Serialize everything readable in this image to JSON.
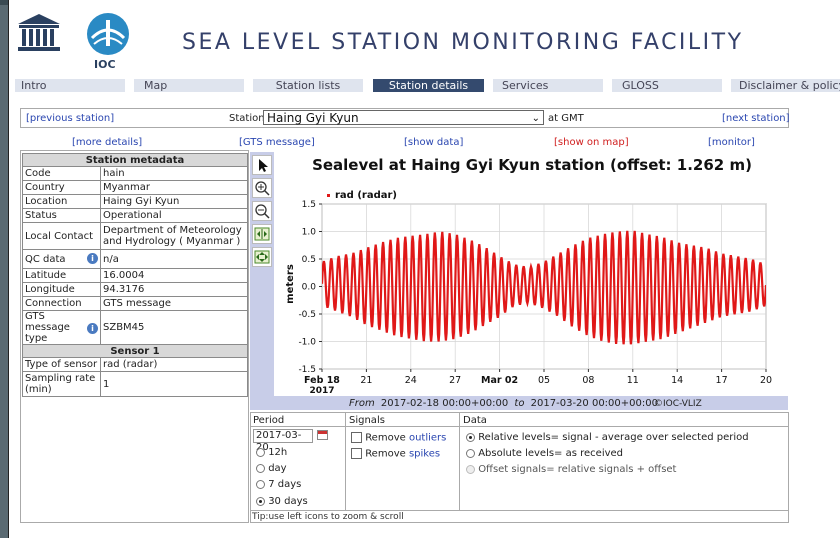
{
  "header": {
    "title": "SEA LEVEL STATION MONITORING FACILITY",
    "ioc_label": "IOC"
  },
  "nav": [
    {
      "label": "Intro",
      "active": false
    },
    {
      "label": "Map",
      "active": false
    },
    {
      "label": "Station lists",
      "active": false
    },
    {
      "label": "Station details",
      "active": true
    },
    {
      "label": "Services",
      "active": false
    },
    {
      "label": "GLOSS",
      "active": false
    },
    {
      "label": "Disclaimer & policy",
      "active": false
    }
  ],
  "station_bar": {
    "prev": "[previous station]",
    "station_label": "Station",
    "station_value": "Haing Gyi Kyun",
    "gmt": "at GMT",
    "next": "[next station]"
  },
  "links": {
    "more_details": "[more details]",
    "gts_message": "[GTS message]",
    "show_data": "[show data]",
    "show_on_map": "[show on map]",
    "monitor": "[monitor]"
  },
  "metadata": {
    "header": "Station metadata",
    "rows": [
      {
        "label": "Code",
        "value": "hain"
      },
      {
        "label": "Country",
        "value": "Myanmar"
      },
      {
        "label": "Location",
        "value": "Haing Gyi Kyun"
      },
      {
        "label": "Status",
        "value": "Operational"
      },
      {
        "label": "Local Contact",
        "value": "Department of Meteorology and Hydrology ( Myanmar )"
      },
      {
        "label": "QC data",
        "value": "n/a"
      },
      {
        "label": "Latitude",
        "value": "16.0004"
      },
      {
        "label": "Longitude",
        "value": "94.3176"
      },
      {
        "label": "Connection",
        "value": "GTS message"
      },
      {
        "label": "GTS message type",
        "value": "SZBM45"
      }
    ],
    "sensor_header": "Sensor 1",
    "sensor_rows": [
      {
        "label": "Type of sensor",
        "value": "rad (radar)"
      },
      {
        "label": "Sampling rate (min)",
        "value": "1"
      }
    ]
  },
  "chart_data": {
    "type": "line",
    "title": "Sealevel at Haing Gyi Kyun station (offset: 1.262 m)",
    "ylabel": "meters",
    "xlabel": "",
    "ylim": [
      -1.5,
      1.5
    ],
    "yticks": [
      -1.5,
      -1.0,
      -0.5,
      0.0,
      0.5,
      1.0,
      1.5
    ],
    "ytick_labels": [
      "-1.5",
      "-1.0",
      "-0.5",
      "0.0",
      "0.5",
      "1.0",
      "1.5"
    ],
    "xlim": [
      "2017-02-18",
      "2017-03-20"
    ],
    "xticks": [
      {
        "date": "2017-02-18",
        "label": "Feb 18",
        "sublabel": "2017",
        "bold": true
      },
      {
        "date": "2017-02-21",
        "label": "21",
        "bold": false
      },
      {
        "date": "2017-02-24",
        "label": "24",
        "bold": false
      },
      {
        "date": "2017-02-27",
        "label": "27",
        "bold": false
      },
      {
        "date": "2017-03-02",
        "label": "Mar 02",
        "bold": true
      },
      {
        "date": "2017-03-05",
        "label": "05",
        "bold": false
      },
      {
        "date": "2017-03-08",
        "label": "08",
        "bold": false
      },
      {
        "date": "2017-03-11",
        "label": "11",
        "bold": false
      },
      {
        "date": "2017-03-14",
        "label": "14",
        "bold": false
      },
      {
        "date": "2017-03-17",
        "label": "17",
        "bold": false
      },
      {
        "date": "2017-03-20",
        "label": "20",
        "bold": false
      }
    ],
    "grid": true,
    "legend_placement": "top-left",
    "series": [
      {
        "name": "rad (radar)",
        "color": "#e01818",
        "x": [
          "2017-02-18",
          "2017-02-19",
          "2017-02-20",
          "2017-02-21",
          "2017-02-22",
          "2017-02-23",
          "2017-02-24",
          "2017-02-25",
          "2017-02-26",
          "2017-02-27",
          "2017-02-28",
          "2017-03-01",
          "2017-03-02",
          "2017-03-03",
          "2017-03-04",
          "2017-03-05",
          "2017-03-06",
          "2017-03-07",
          "2017-03-08",
          "2017-03-09",
          "2017-03-10",
          "2017-03-11",
          "2017-03-12",
          "2017-03-13",
          "2017-03-14",
          "2017-03-15",
          "2017-03-16",
          "2017-03-17",
          "2017-03-18",
          "2017-03-19",
          "2017-03-20"
        ],
        "high": [
          0.45,
          0.55,
          0.6,
          0.7,
          0.8,
          0.88,
          0.92,
          0.95,
          1.0,
          0.95,
          0.85,
          0.72,
          0.55,
          0.4,
          0.35,
          0.45,
          0.6,
          0.75,
          0.88,
          0.95,
          1.0,
          1.02,
          0.95,
          0.9,
          0.8,
          0.75,
          0.7,
          0.6,
          0.55,
          0.5,
          0.4
        ],
        "low": [
          -0.35,
          -0.45,
          -0.55,
          -0.7,
          -0.8,
          -0.9,
          -0.95,
          -1.0,
          -1.0,
          -0.95,
          -0.85,
          -0.7,
          -0.55,
          -0.35,
          -0.3,
          -0.4,
          -0.55,
          -0.75,
          -0.9,
          -1.0,
          -1.05,
          -1.05,
          -1.0,
          -0.95,
          -0.85,
          -0.75,
          -0.65,
          -0.55,
          -0.5,
          -0.45,
          -0.35
        ]
      }
    ],
    "footer_from_label": "From",
    "footer_from": "2017-02-18 00:00+00:00",
    "footer_to_label": "to",
    "footer_to": "2017-03-20 00:00+00:00",
    "credit": "©IOC-VLIZ"
  },
  "controls": {
    "period_header": "Period",
    "period_date": "2017-03-20",
    "period_options": [
      {
        "label": "12h",
        "selected": false
      },
      {
        "label": "day",
        "selected": false
      },
      {
        "label": "7 days",
        "selected": false
      },
      {
        "label": "30 days",
        "selected": true
      }
    ],
    "signals_header": "Signals",
    "signals_options": [
      {
        "pre": "Remove ",
        "link": "outliers"
      },
      {
        "pre": "Remove ",
        "link": "spikes"
      }
    ],
    "data_header": "Data",
    "data_options": [
      {
        "label": "Relative levels= signal - average over selected period",
        "selected": true,
        "disabled": false
      },
      {
        "label": "Absolute levels= as received",
        "selected": false,
        "disabled": false
      },
      {
        "label": "Offset signals= relative signals + offset",
        "selected": false,
        "disabled": true
      }
    ],
    "tip": "Tip:use left icons to zoom & scroll"
  }
}
